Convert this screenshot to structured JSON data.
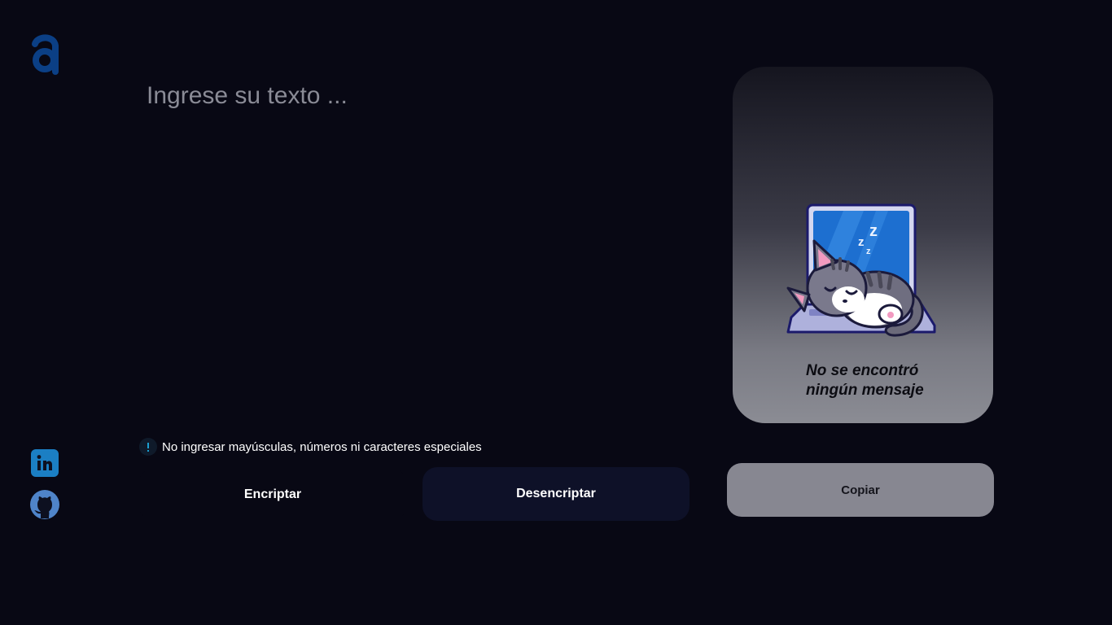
{
  "brand": {
    "logo_icon": "letter-a-logo-icon",
    "color": "#0b3f85"
  },
  "social": [
    {
      "name": "linkedin",
      "icon": "linkedin-icon",
      "color": "#1b7fc4"
    },
    {
      "name": "github",
      "icon": "github-icon",
      "color": "#4f84c9"
    }
  ],
  "input": {
    "placeholder": "Ingrese su texto ...",
    "value": ""
  },
  "info": {
    "icon": "info-exclamation-icon",
    "text": "No ingresar mayúsculas, números ni caracteres especiales"
  },
  "buttons": {
    "encrypt": "Encriptar",
    "decrypt": "Desencriptar",
    "copy": "Copiar"
  },
  "result": {
    "illustration": "sleeping-cat-on-laptop",
    "message_line1": "No se encontró",
    "message_line2": "ningún mensaje"
  },
  "colors": {
    "background": "#080814",
    "decrypt_button": "#0e1128",
    "copy_button": "#878791",
    "panel_top": "#15151f",
    "panel_bottom": "#8b8c94"
  }
}
